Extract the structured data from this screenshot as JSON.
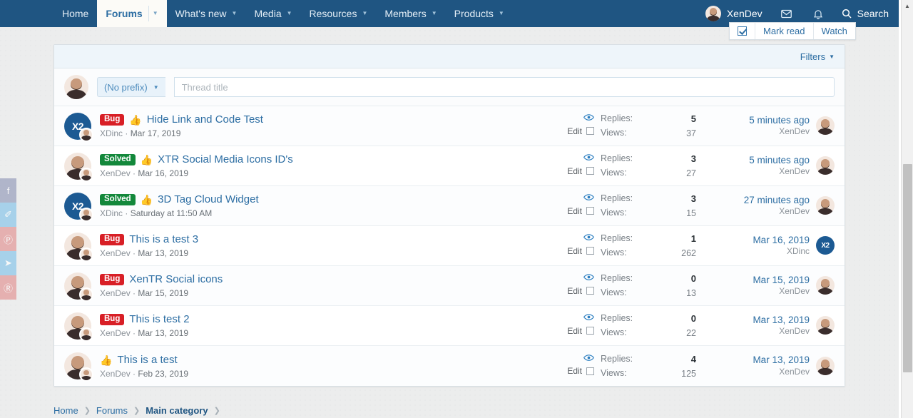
{
  "navbar": {
    "items": [
      {
        "label": "Home",
        "caret": false,
        "active": false
      },
      {
        "label": "Forums",
        "caret": true,
        "active": true
      },
      {
        "label": "What's new",
        "caret": true,
        "active": false
      },
      {
        "label": "Media",
        "caret": true,
        "active": false
      },
      {
        "label": "Resources",
        "caret": true,
        "active": false
      },
      {
        "label": "Members",
        "caret": true,
        "active": false
      },
      {
        "label": "Products",
        "caret": true,
        "active": false
      }
    ],
    "user": "XenDev",
    "inbox_icon": "envelope-icon",
    "alerts_icon": "bell-icon",
    "search_label": "Search",
    "search_icon": "search-icon",
    "accent": "#1f5582"
  },
  "markread_bar": {
    "checkbox_checked": true,
    "mark_read_label": "Mark read",
    "watch_label": "Watch"
  },
  "social_strip": [
    {
      "name": "facebook-share-icon",
      "glyph": "f",
      "color": "#8b93b5"
    },
    {
      "name": "twitter-share-icon",
      "glyph": "✐",
      "color": "#7cc0e8"
    },
    {
      "name": "pinterest-share-icon",
      "glyph": "Ⓟ",
      "color": "#e08b8b"
    },
    {
      "name": "telegram-share-icon",
      "glyph": "➤",
      "color": "#7cc0e8"
    },
    {
      "name": "reddit-share-icon",
      "glyph": "Ⓡ",
      "color": "#e08b8b"
    }
  ],
  "block": {
    "filters_label": "Filters",
    "quick_thread": {
      "avatar": "XenDev",
      "prefix_label": "(No prefix)",
      "title_placeholder": "Thread title",
      "title_value": ""
    },
    "row_labels": {
      "replies": "Replies:",
      "views": "Views:",
      "edit": "Edit",
      "watch_icon": "eye-icon"
    },
    "threads": [
      {
        "prefix": "Bug",
        "prefix_type": "bug",
        "emoji": "👍",
        "title": "Hide Link and Code Test",
        "author": "XDinc",
        "date": "Mar 17, 2019",
        "avatar_type": "brand",
        "avatar_text": "X2",
        "replies": "5",
        "views": "37",
        "last_date": "5 minutes ago",
        "last_user": "XenDev",
        "last_avatar_type": "person",
        "last_avatar_text": ""
      },
      {
        "prefix": "Solved",
        "prefix_type": "solved",
        "emoji": "👍",
        "title": "XTR Social Media Icons ID's",
        "author": "XenDev",
        "date": "Mar 16, 2019",
        "avatar_type": "person",
        "avatar_text": "",
        "replies": "3",
        "views": "27",
        "last_date": "5 minutes ago",
        "last_user": "XenDev",
        "last_avatar_type": "person",
        "last_avatar_text": ""
      },
      {
        "prefix": "Solved",
        "prefix_type": "solved",
        "emoji": "👍",
        "title": "3D Tag Cloud Widget",
        "author": "XDinc",
        "date": "Saturday at 11:50 AM",
        "avatar_type": "brand",
        "avatar_text": "X2",
        "replies": "3",
        "views": "15",
        "last_date": "27 minutes ago",
        "last_user": "XenDev",
        "last_avatar_type": "person",
        "last_avatar_text": ""
      },
      {
        "prefix": "Bug",
        "prefix_type": "bug",
        "emoji": "",
        "title": "This is a test 3",
        "author": "XenDev",
        "date": "Mar 13, 2019",
        "avatar_type": "person",
        "avatar_text": "",
        "replies": "1",
        "views": "262",
        "last_date": "Mar 16, 2019",
        "last_user": "XDinc",
        "last_avatar_type": "brand",
        "last_avatar_text": "X2"
      },
      {
        "prefix": "Bug",
        "prefix_type": "bug",
        "emoji": "",
        "title": "XenTR Social icons",
        "author": "XenDev",
        "date": "Mar 15, 2019",
        "avatar_type": "person",
        "avatar_text": "",
        "replies": "0",
        "views": "13",
        "last_date": "Mar 15, 2019",
        "last_user": "XenDev",
        "last_avatar_type": "person",
        "last_avatar_text": ""
      },
      {
        "prefix": "Bug",
        "prefix_type": "bug",
        "emoji": "",
        "title": "This is test 2",
        "author": "XenDev",
        "date": "Mar 13, 2019",
        "avatar_type": "person",
        "avatar_text": "",
        "replies": "0",
        "views": "22",
        "last_date": "Mar 13, 2019",
        "last_user": "XenDev",
        "last_avatar_type": "person",
        "last_avatar_text": ""
      },
      {
        "prefix": "",
        "prefix_type": "",
        "emoji": "👍",
        "title": "This is a test",
        "author": "XenDev",
        "date": "Feb 23, 2019",
        "avatar_type": "person",
        "avatar_text": "",
        "replies": "4",
        "views": "125",
        "last_date": "Mar 13, 2019",
        "last_user": "XenDev",
        "last_avatar_type": "person",
        "last_avatar_text": ""
      }
    ]
  },
  "breadcrumb": [
    {
      "label": "Home",
      "current": false
    },
    {
      "label": "Forums",
      "current": false
    },
    {
      "label": "Main category",
      "current": true
    }
  ],
  "colors": {
    "nav_blue": "#1f5582",
    "link_blue": "#2d6ea3",
    "bug_red": "#d81f26",
    "solved_green": "#13883b"
  }
}
